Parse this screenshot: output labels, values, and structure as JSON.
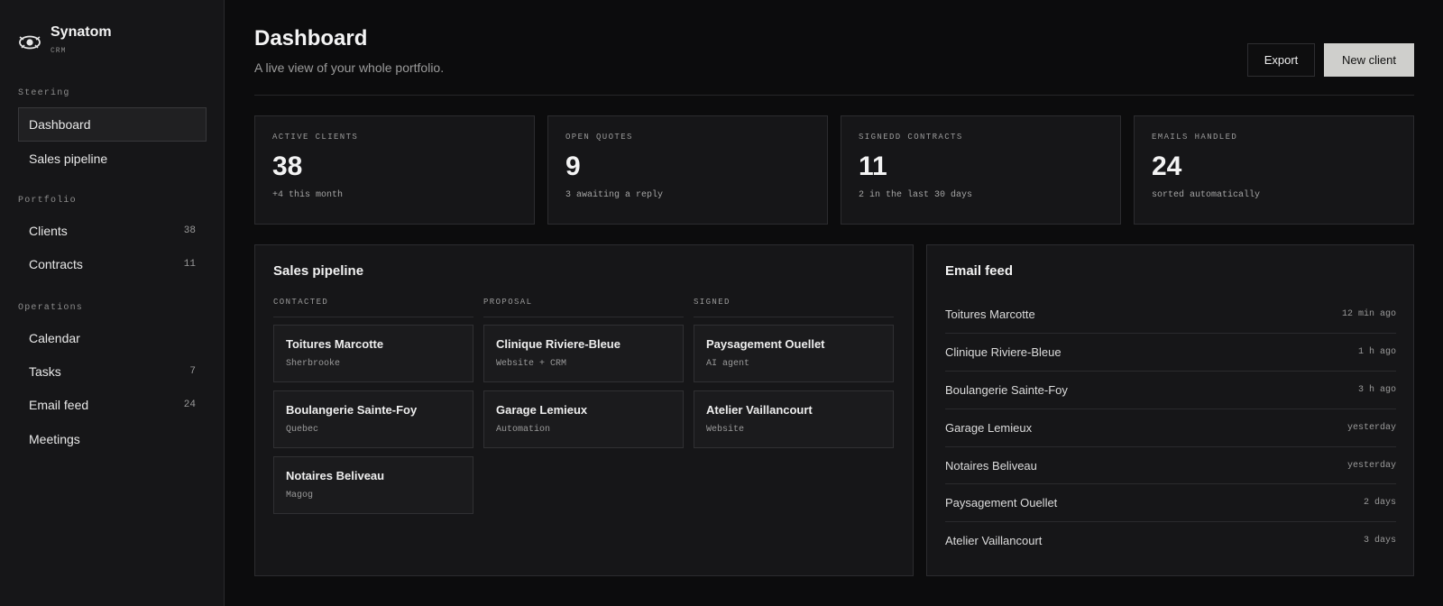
{
  "brand": {
    "name": "Synatom",
    "sub": "CRM",
    "icon": "eye-icon"
  },
  "sidebar": {
    "sections": [
      "Steering",
      "Portfolio",
      "Operations"
    ],
    "items": [
      {
        "label": "Dashboard",
        "count": ""
      },
      {
        "label": "Sales pipeline",
        "count": ""
      },
      {
        "label": "Clients",
        "count": "38"
      },
      {
        "label": "Contracts",
        "count": "11"
      },
      {
        "label": "Calendar",
        "count": ""
      },
      {
        "label": "Tasks",
        "count": "7"
      },
      {
        "label": "Email feed",
        "count": "24"
      },
      {
        "label": "Meetings",
        "count": ""
      }
    ]
  },
  "header": {
    "title": "Dashboard",
    "subtitle": "A live view of your whole portfolio.",
    "export_label": "Export",
    "new_label": "New client"
  },
  "stats": [
    {
      "label": "ACTIVE CLIENTS",
      "value": "38",
      "note": "+4 this month"
    },
    {
      "label": "OPEN QUOTES",
      "value": "9",
      "note": "3 awaiting a reply"
    },
    {
      "label": "SIGNEDD CONTRACTS",
      "value": "11",
      "note": "2 in the last 30 days"
    },
    {
      "label": "EMAILS HANDLED",
      "value": "24",
      "note": "sorted automatically"
    }
  ],
  "pipeline": {
    "title": "Sales pipeline",
    "columns": [
      {
        "label": "CONTACTED",
        "cards": [
          {
            "name": "Toitures Marcotte",
            "sub": "Sherbrooke"
          },
          {
            "name": "Boulangerie Sainte-Foy",
            "sub": "Quebec"
          },
          {
            "name": "Notaires Beliveau",
            "sub": "Magog"
          }
        ]
      },
      {
        "label": "PROPOSAL",
        "cards": [
          {
            "name": "Clinique Riviere-Bleue",
            "sub": "Website + CRM"
          },
          {
            "name": "Garage Lemieux",
            "sub": "Automation"
          }
        ]
      },
      {
        "label": "SIGNED",
        "cards": [
          {
            "name": "Paysagement Ouellet",
            "sub": "AI agent"
          },
          {
            "name": "Atelier Vaillancourt",
            "sub": "Website"
          }
        ]
      }
    ]
  },
  "email_feed": {
    "title": "Email feed",
    "items": [
      {
        "name": "Toitures Marcotte",
        "time": "12 min ago"
      },
      {
        "name": "Clinique Riviere-Bleue",
        "time": "1 h ago"
      },
      {
        "name": "Boulangerie Sainte-Foy",
        "time": "3 h ago"
      },
      {
        "name": "Garage Lemieux",
        "time": "yesterday"
      },
      {
        "name": "Notaires Beliveau",
        "time": "yesterday"
      },
      {
        "name": "Paysagement Ouellet",
        "time": "2 days"
      },
      {
        "name": "Atelier Vaillancourt",
        "time": "3 days"
      }
    ]
  }
}
